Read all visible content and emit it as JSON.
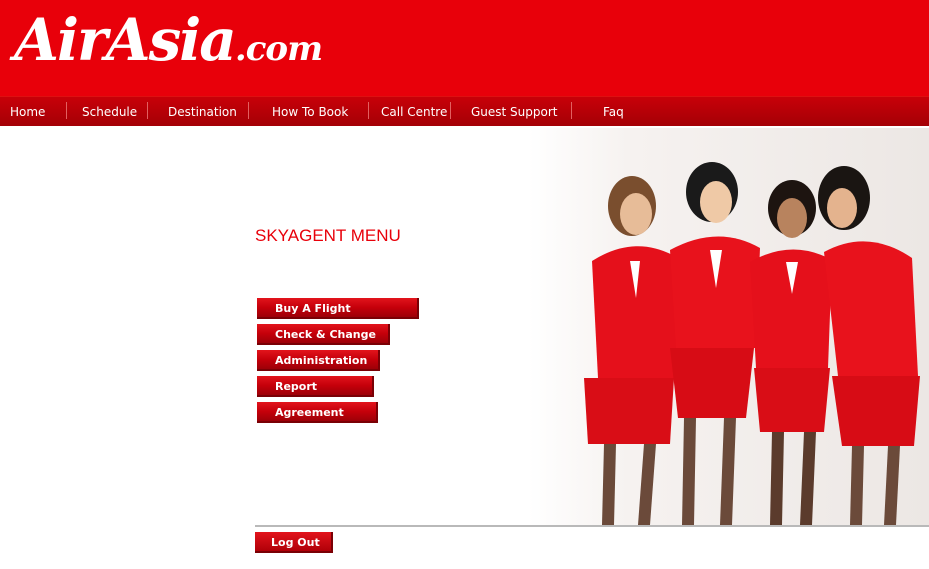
{
  "brand": {
    "logo_main": "AirAsia",
    "logo_suffix": ".com",
    "color": "#e8000a"
  },
  "nav": {
    "items": [
      "Home",
      "Schedule",
      "Destination",
      "How To Book",
      "Call Centre",
      "Guest Support",
      "Faq"
    ]
  },
  "menu": {
    "title": "SKYAGENT MENU",
    "buttons": [
      "Buy A Flight",
      "Check & Change",
      "Administration",
      "Report",
      "Agreement"
    ]
  },
  "footer": {
    "logout_label": "Log Out"
  },
  "hero_image": {
    "icon": "flight-attendants-photo"
  }
}
